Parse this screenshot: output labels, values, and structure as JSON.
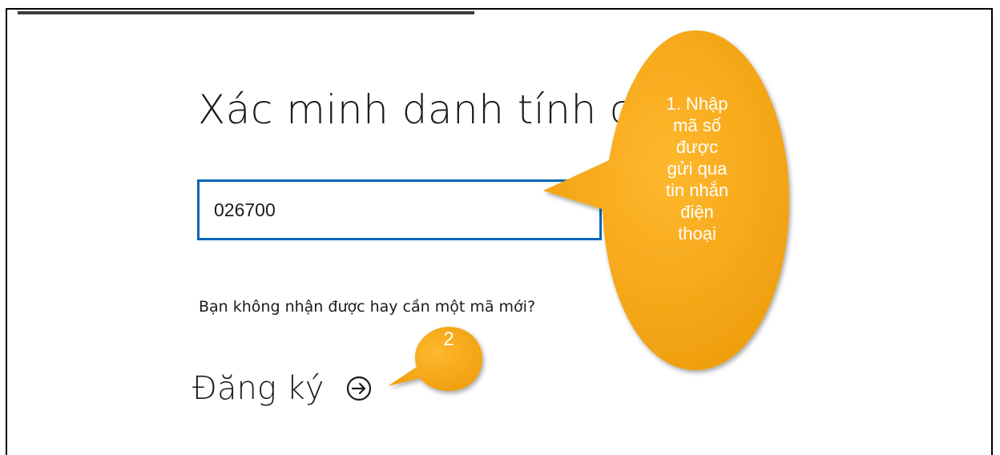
{
  "page": {
    "title": "Xác minh danh tính của bạn",
    "code_value": "026700",
    "resend_text": "Bạn không nhận được hay cần một mã mới?",
    "signin_label": "Đăng ký"
  },
  "annotations": {
    "callout_1": "1. Nhập\nmã số\nđược\ngửi qua\ntin nhắn\nđiện\nthoại",
    "badge_2": "2",
    "color": "#f5a623"
  },
  "icons": {
    "signin": "arrow-right-circle-icon"
  }
}
